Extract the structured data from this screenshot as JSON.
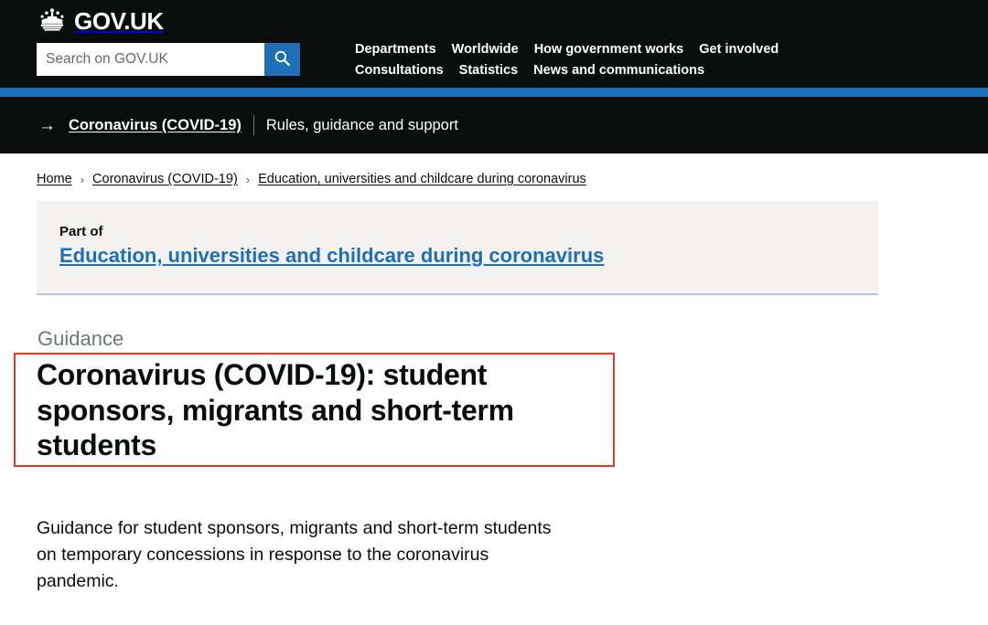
{
  "header": {
    "logo_text": "GOV.UK",
    "crown_icon": "crown-icon",
    "search": {
      "placeholder": "Search on GOV.UK",
      "value": "",
      "button_icon": "search-icon"
    },
    "nav": {
      "row1": [
        "Departments",
        "Worldwide",
        "How government works",
        "Get involved"
      ],
      "row2": [
        "Consultations",
        "Statistics",
        "News and communications"
      ]
    },
    "accent_color": "#1d70b8",
    "background_color": "#0b0c0c"
  },
  "covid_banner": {
    "arrow_icon": "arrow-right-icon",
    "link_label": "Coronavirus (COVID-19)",
    "description": "Rules, guidance and support"
  },
  "breadcrumb": {
    "separator": "›",
    "items": [
      "Home",
      "Coronavirus (COVID-19)",
      "Education, universities and childcare during coronavirus"
    ]
  },
  "part_of": {
    "label": "Part of",
    "link_label": "Education, universities and childcare during coronavirus",
    "background_color": "#f3f2f1",
    "border_color": "#b1c7d6",
    "link_color": "#1d70b8"
  },
  "page": {
    "kicker": "Guidance",
    "title": "Coronavirus (COVID-19): student sponsors, migrants and short-term students",
    "lede": "Guidance for student sponsors, migrants and short-term students on temporary concessions in response to the coronavirus pandemic."
  },
  "annotation": {
    "highlight_color": "#e8362b",
    "target": "page-title"
  }
}
